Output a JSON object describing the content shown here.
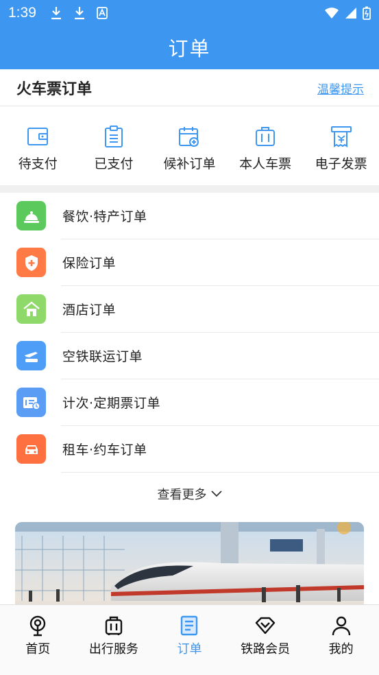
{
  "status_bar": {
    "time": "1:39"
  },
  "header": {
    "title": "订单"
  },
  "section": {
    "title": "火车票订单",
    "tips": "温馨提示"
  },
  "quick": [
    {
      "label": "待支付",
      "icon": "wallet-icon"
    },
    {
      "label": "已支付",
      "icon": "clipboard-icon"
    },
    {
      "label": "候补订单",
      "icon": "calendar-add-icon"
    },
    {
      "label": "本人车票",
      "icon": "suitcase-icon"
    },
    {
      "label": "电子发票",
      "icon": "invoice-icon"
    }
  ],
  "orders": [
    {
      "label": "餐饮·特产订单",
      "icon": "dining-bell-icon",
      "color": "#5cc95c"
    },
    {
      "label": "保险订单",
      "icon": "shield-cross-icon",
      "color": "#ff7a45"
    },
    {
      "label": "酒店订单",
      "icon": "hotel-icon",
      "color": "#8fd96a"
    },
    {
      "label": "空铁联运订单",
      "icon": "plane-train-icon",
      "color": "#4e9ef7"
    },
    {
      "label": "计次·定期票订单",
      "icon": "ticket-clock-icon",
      "color": "#5b9df5"
    },
    {
      "label": "租车·约车订单",
      "icon": "car-icon",
      "color": "#ff7040"
    }
  ],
  "more": {
    "label": "查看更多"
  },
  "nav": [
    {
      "label": "首页",
      "icon": "railway-logo-icon",
      "active": false
    },
    {
      "label": "出行服务",
      "icon": "luggage-icon",
      "active": false
    },
    {
      "label": "订单",
      "icon": "order-doc-icon",
      "active": true
    },
    {
      "label": "铁路会员",
      "icon": "diamond-icon",
      "active": false
    },
    {
      "label": "我的",
      "icon": "person-icon",
      "active": false
    }
  ],
  "colors": {
    "primary": "#3d97f1"
  }
}
